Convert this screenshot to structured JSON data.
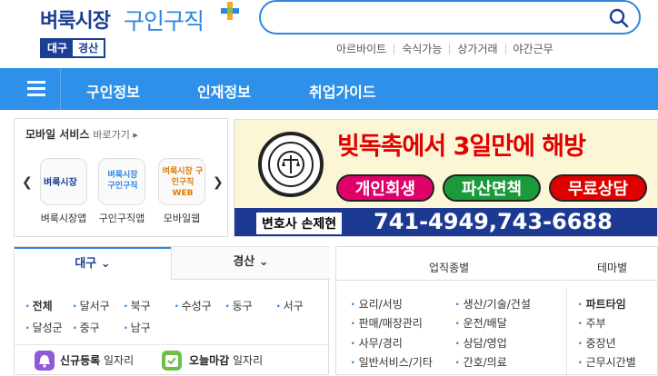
{
  "logo": {
    "main": "벼룩시장",
    "sub": "구인구직"
  },
  "region": {
    "primary": "대구",
    "secondary": "경산"
  },
  "search": {
    "placeholder": ""
  },
  "quick_links": [
    "아르바이트",
    "숙식가능",
    "상가거래",
    "야간근무"
  ],
  "nav": {
    "items": [
      "구인정보",
      "인재정보",
      "취업가이드"
    ]
  },
  "mobile": {
    "title": "모바일 서비스",
    "more": "바로가기 ▸",
    "apps": [
      {
        "label": "벼룩시장앱",
        "icon_text": "벼룩시장"
      },
      {
        "label": "구인구직앱",
        "icon_text": "벼룩시장 구인구직"
      },
      {
        "label": "모바일웹",
        "icon_text": "벼룩시장 구인구직 WEB"
      }
    ]
  },
  "banner": {
    "headline": "빚독촉에서 3일만에 해방",
    "pills": [
      "개인회생",
      "파산면책",
      "무료상담"
    ],
    "lawyer": "변호사 손제현",
    "phone": "741-4949,743-6688"
  },
  "location": {
    "tabs": [
      "대구 ⌄",
      "경산 ⌄"
    ],
    "districts": [
      "전체",
      "달서구",
      "북구",
      "수성구",
      "동구",
      "서구",
      "달성군",
      "중구",
      "남구"
    ],
    "badges": [
      {
        "strong": "신규등록",
        "rest": "일자리"
      },
      {
        "strong": "오늘마감",
        "rest": "일자리"
      }
    ]
  },
  "categories": {
    "header_left": "업직종별",
    "header_right": "테마별",
    "col1": [
      "요리/서빙",
      "판매/매장관리",
      "사무/경리",
      "일반서비스/기타"
    ],
    "col2": [
      "생산/기술/건설",
      "운전/배달",
      "상담/영업",
      "간호/의료"
    ],
    "themes": [
      "파트타임",
      "주부",
      "중장년",
      "근무시간별"
    ]
  },
  "colors": {
    "brand_navy": "#1b3f94",
    "brand_blue": "#2e86e0",
    "nav_blue": "#2e90e8",
    "banner_red": "#e00000"
  }
}
